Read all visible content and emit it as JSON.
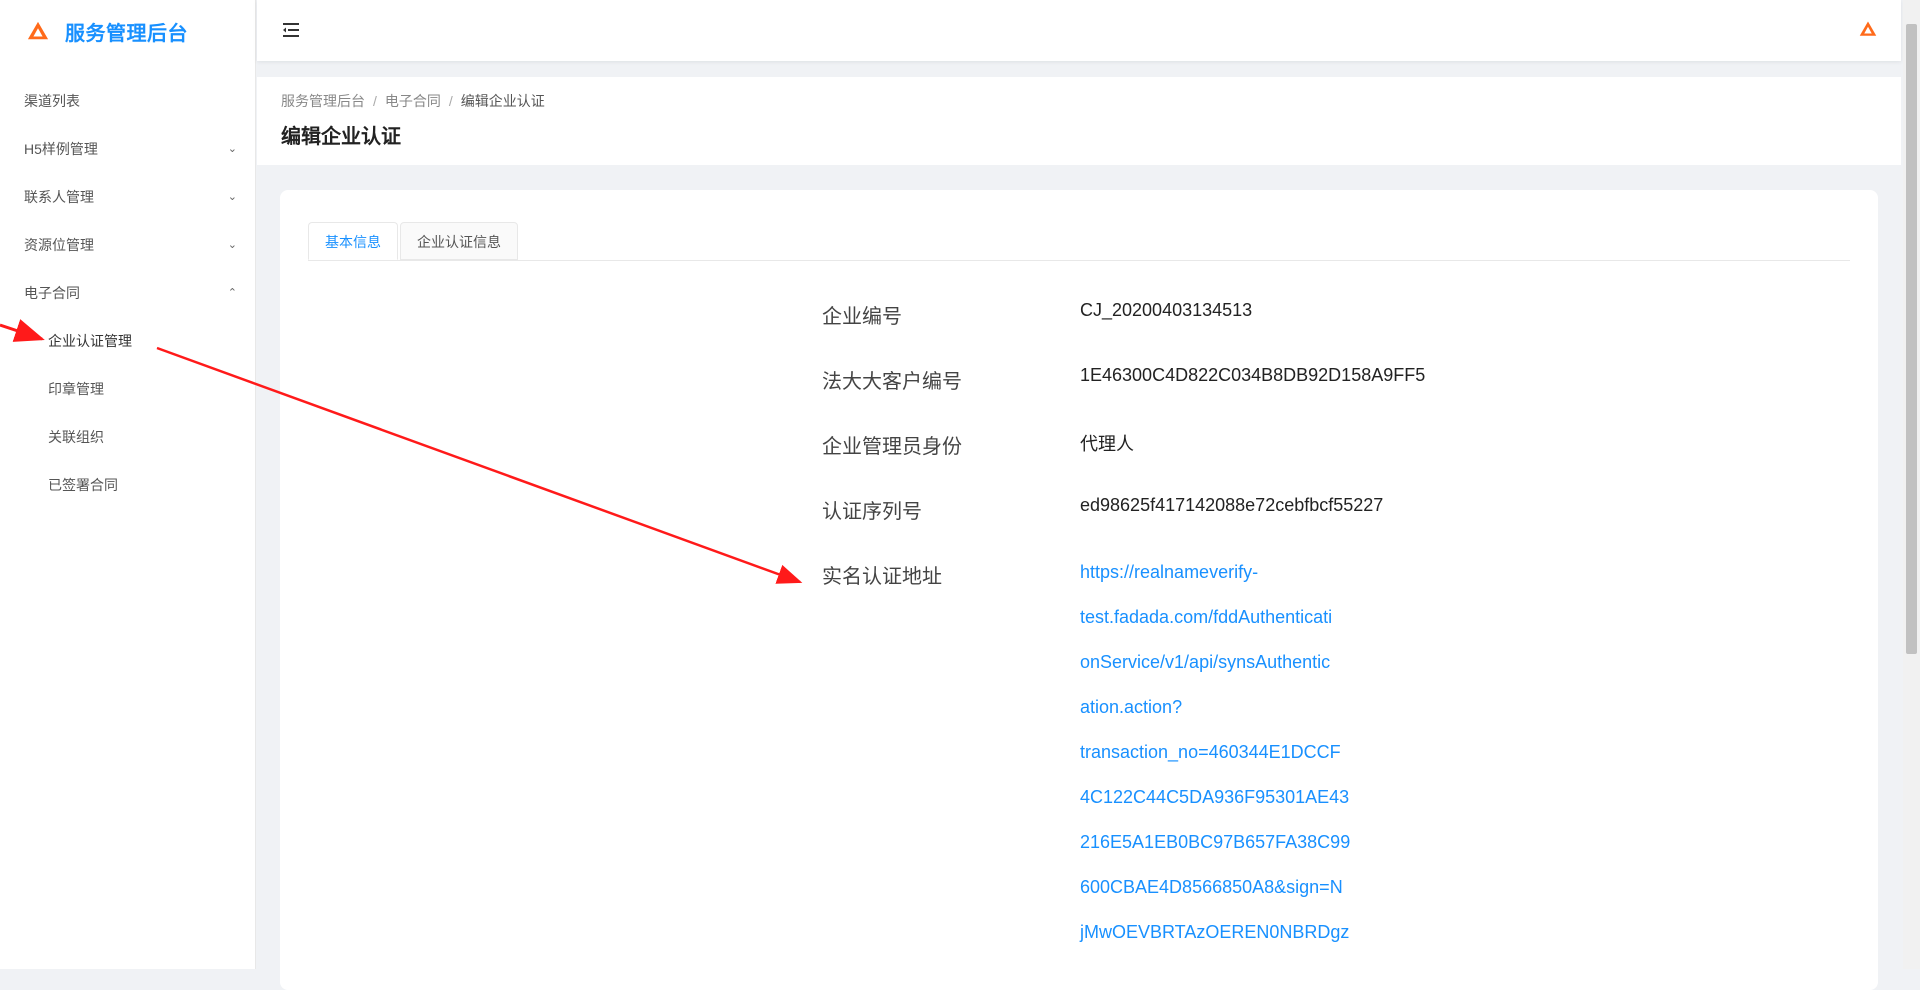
{
  "app": {
    "title": "服务管理后台"
  },
  "sidebar": {
    "items": [
      {
        "label": "渠道列表",
        "chevron": ""
      },
      {
        "label": "H5样例管理",
        "chevron": "⌄"
      },
      {
        "label": "联系人管理",
        "chevron": "⌄"
      },
      {
        "label": "资源位管理",
        "chevron": "⌄"
      },
      {
        "label": "电子合同",
        "chevron": "⌃"
      }
    ],
    "subitems": [
      {
        "label": "企业认证管理"
      },
      {
        "label": "印章管理"
      },
      {
        "label": "关联组织"
      },
      {
        "label": "已签署合同"
      }
    ]
  },
  "breadcrumb": [
    "服务管理后台",
    "电子合同",
    "编辑企业认证"
  ],
  "page": {
    "title": "编辑企业认证"
  },
  "tabs": [
    "基本信息",
    "企业认证信息"
  ],
  "fields": [
    {
      "label": "企业编号",
      "value": "CJ_20200403134513"
    },
    {
      "label": "法大大客户编号",
      "value": "1E46300C4D822C034B8DB92D158A9FF5"
    },
    {
      "label": "企业管理员身份",
      "value": "代理人"
    },
    {
      "label": "认证序列号",
      "value": "ed98625f417142088e72cebfbcf55227"
    },
    {
      "label": "实名认证地址"
    }
  ],
  "auth_url_lines": [
    "https://realnameverify-",
    "test.fadada.com/fddAuthenticati",
    "onService/v1/api/synsAuthentic",
    "ation.action?",
    "transaction_no=460344E1DCCF",
    "4C122C44C5DA936F95301AE43",
    "216E5A1EB0BC97B657FA38C99",
    "600CBAE4D8566850A8&sign=N",
    "jMwOEVBRTAzOEREN0NBRDgz"
  ],
  "colors": {
    "accent": "#1890ff",
    "annotation": "#ff1a1a"
  }
}
